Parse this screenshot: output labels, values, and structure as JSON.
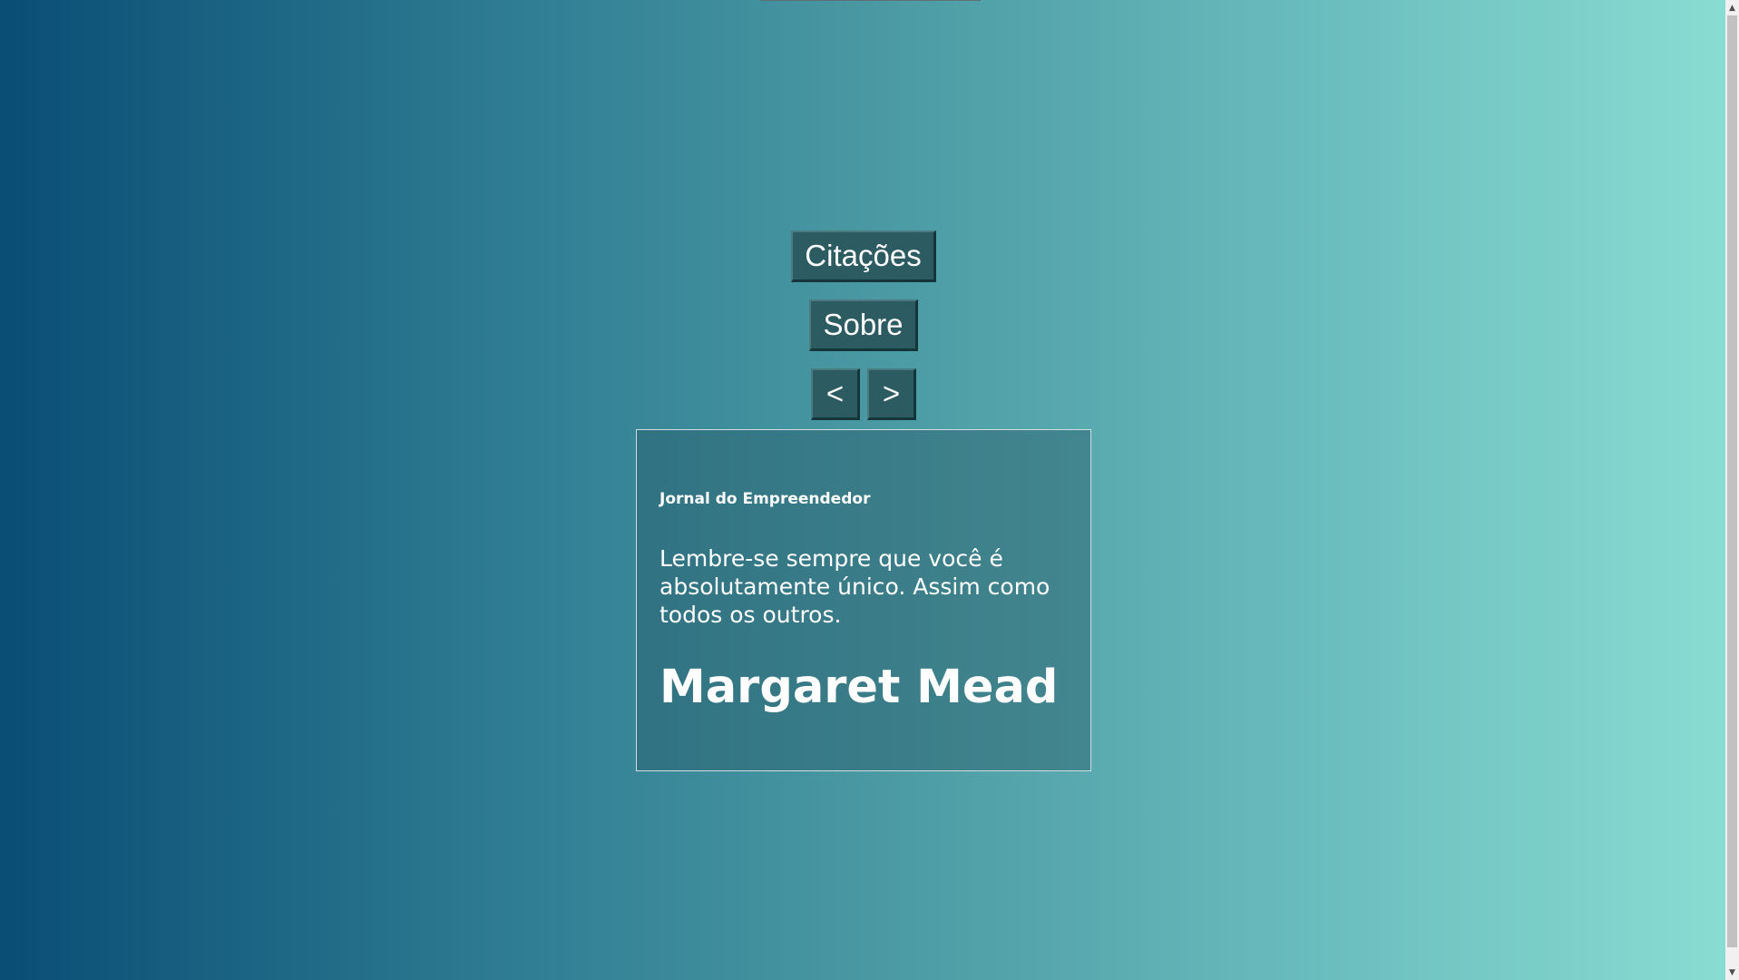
{
  "nav": {
    "citacoes_label": "Citações",
    "sobre_label": "Sobre",
    "prev_label": "<",
    "next_label": ">"
  },
  "quote": {
    "source": "Jornal do Empreendedor",
    "text": "Lembre-se sempre que você é absolutamente único. Assim como todos os outros.",
    "author": "Margaret Mead"
  },
  "scrollbar": {
    "up_icon": "▲",
    "down_icon": "▼"
  },
  "colors": {
    "gradient_start": "#0a4d75",
    "gradient_end": "#88dcd1",
    "button_bg": "#2c5b62"
  }
}
